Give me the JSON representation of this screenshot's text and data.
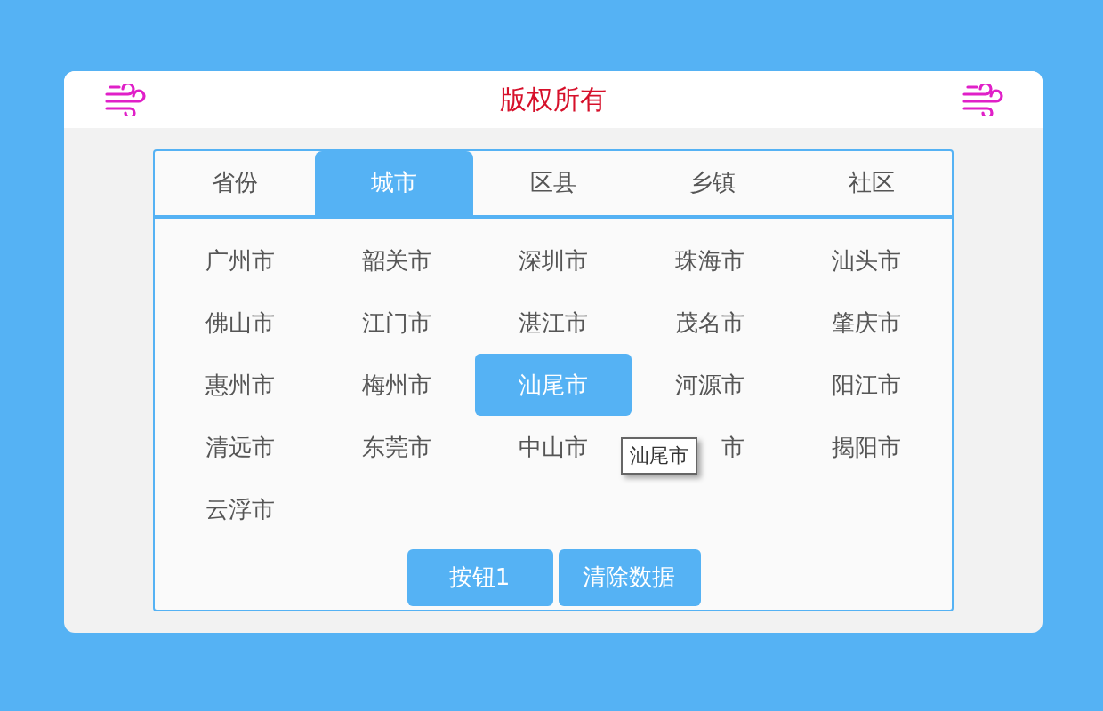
{
  "header": {
    "title": "版权所有"
  },
  "tabs": [
    {
      "label": "省份",
      "selected": false
    },
    {
      "label": "城市",
      "selected": true
    },
    {
      "label": "区县",
      "selected": false
    },
    {
      "label": "乡镇",
      "selected": false
    },
    {
      "label": "社区",
      "selected": false
    }
  ],
  "items": [
    {
      "label": "广州市",
      "selected": false,
      "covered": false
    },
    {
      "label": "韶关市",
      "selected": false,
      "covered": false
    },
    {
      "label": "深圳市",
      "selected": false,
      "covered": false
    },
    {
      "label": "珠海市",
      "selected": false,
      "covered": false
    },
    {
      "label": "汕头市",
      "selected": false,
      "covered": false
    },
    {
      "label": "佛山市",
      "selected": false,
      "covered": false
    },
    {
      "label": "江门市",
      "selected": false,
      "covered": false
    },
    {
      "label": "湛江市",
      "selected": false,
      "covered": false
    },
    {
      "label": "茂名市",
      "selected": false,
      "covered": false
    },
    {
      "label": "肇庆市",
      "selected": false,
      "covered": false
    },
    {
      "label": "惠州市",
      "selected": false,
      "covered": false
    },
    {
      "label": "梅州市",
      "selected": false,
      "covered": false
    },
    {
      "label": "汕尾市",
      "selected": true,
      "covered": false
    },
    {
      "label": "河源市",
      "selected": false,
      "covered": false
    },
    {
      "label": "阳江市",
      "selected": false,
      "covered": false
    },
    {
      "label": "清远市",
      "selected": false,
      "covered": false
    },
    {
      "label": "东莞市",
      "selected": false,
      "covered": false
    },
    {
      "label": "中山市",
      "selected": false,
      "covered": false
    },
    {
      "label": "市",
      "selected": false,
      "covered": true
    },
    {
      "label": "揭阳市",
      "selected": false,
      "covered": false
    },
    {
      "label": "云浮市",
      "selected": false,
      "covered": false
    }
  ],
  "tooltip": {
    "text": "汕尾市"
  },
  "buttons": [
    "按钮1",
    "清除数据"
  ]
}
